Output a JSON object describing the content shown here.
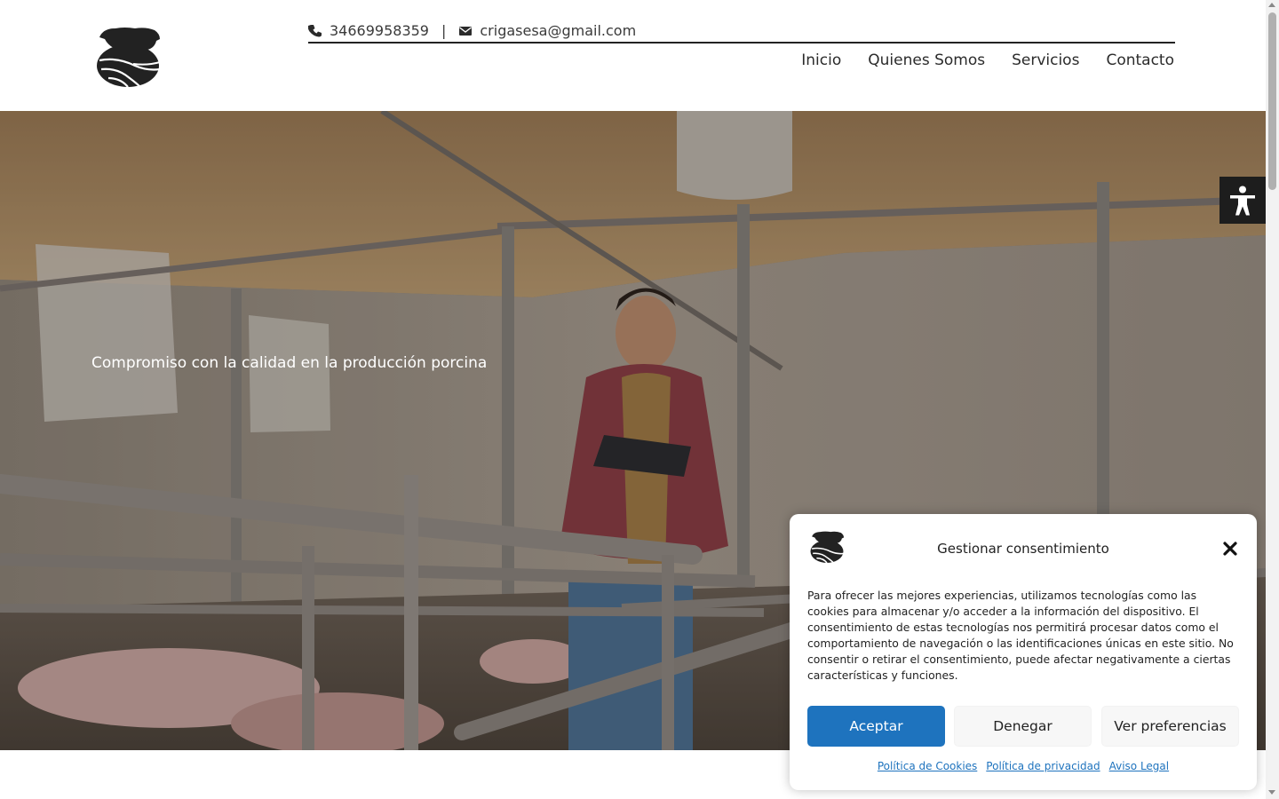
{
  "header": {
    "phone": "34669958359",
    "separator": "|",
    "email": "crigasesa@gmail.com",
    "nav": [
      "Inicio",
      "Quienes Somos",
      "Servicios",
      "Contacto"
    ]
  },
  "hero": {
    "tagline": "Compromiso con la calidad en la producción porcina"
  },
  "consent": {
    "title": "Gestionar consentimiento",
    "body": "Para ofrecer las mejores experiencias, utilizamos tecnologías como las cookies para almacenar y/o acceder a la información del dispositivo. El consentimiento de estas tecnologías nos permitirá procesar datos como el comportamiento de navegación o las identificaciones únicas en este sitio. No consentir o retirar el consentimiento, puede afectar negativamente a ciertas características y funciones.",
    "accept": "Aceptar",
    "deny": "Denegar",
    "preferences": "Ver preferencias",
    "links": [
      "Política de Cookies",
      "Política de privacidad",
      "Aviso Legal"
    ]
  },
  "colors": {
    "accent": "#1e73be",
    "dark": "#1d1d1d"
  },
  "icons": [
    "pig-logo",
    "phone-icon",
    "envelope-icon",
    "accessibility-icon",
    "close-icon"
  ]
}
